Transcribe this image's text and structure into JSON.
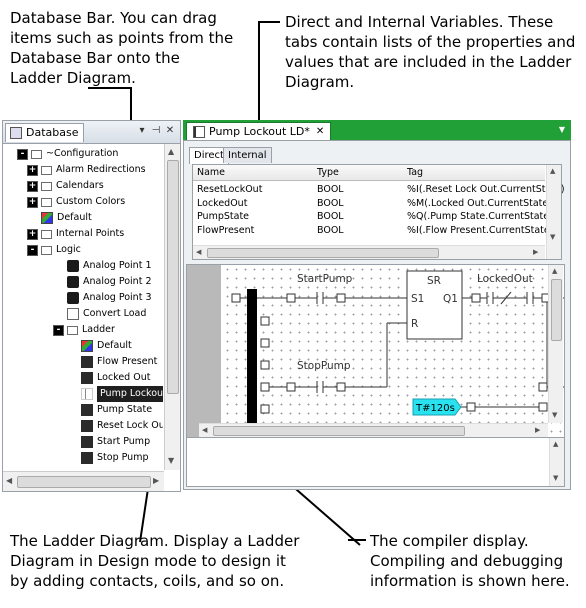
{
  "callouts": {
    "database_bar": "Database Bar. You can drag items such as points from the Database Bar onto the Ladder Diagram.",
    "variables": "Direct and Internal Variables. These tabs contain lists of the properties and values that are included in the Ladder Diagram.",
    "ladder": "The Ladder Diagram. Display a Ladder Diagram in Design mode to design it by adding contacts, coils, and so on.",
    "compiler": "The compiler display. Compiling and debugging information is shown here."
  },
  "database_pane": {
    "tab_label": "Database",
    "tree": [
      {
        "label": "~Configuration",
        "level": 0,
        "expander": "-",
        "icon": "folder-icon"
      },
      {
        "label": "Alarm Redirections",
        "level": 1,
        "expander": "+",
        "icon": "folder-icon"
      },
      {
        "label": "Calendars",
        "level": 1,
        "expander": "+",
        "icon": "folder-icon"
      },
      {
        "label": "Custom Colors",
        "level": 1,
        "expander": "+",
        "icon": "folder-icon"
      },
      {
        "label": "Default",
        "level": 1,
        "expander": "",
        "icon": "color-palette-icon"
      },
      {
        "label": "Internal Points",
        "level": 1,
        "expander": "+",
        "icon": "folder-icon"
      },
      {
        "label": "Logic",
        "level": 1,
        "expander": "-",
        "icon": "folder-icon"
      },
      {
        "label": "Analog Point 1",
        "level": 2,
        "expander": "",
        "icon": "analog-point-icon"
      },
      {
        "label": "Analog Point 2",
        "level": 2,
        "expander": "",
        "icon": "analog-point-icon"
      },
      {
        "label": "Analog Point 3",
        "level": 2,
        "expander": "",
        "icon": "analog-point-icon"
      },
      {
        "label": "Convert Load",
        "level": 2,
        "expander": "",
        "icon": "document-icon"
      },
      {
        "label": "Ladder",
        "level": 2,
        "expander": "-",
        "icon": "folder-icon"
      },
      {
        "label": "Default",
        "level": 3,
        "expander": "",
        "icon": "color-palette-icon"
      },
      {
        "label": "Flow Present",
        "level": 3,
        "expander": "",
        "icon": "digital-point-icon"
      },
      {
        "label": "Locked Out",
        "level": 3,
        "expander": "",
        "icon": "digital-point-icon"
      },
      {
        "label": "Pump Lockout LD",
        "level": 3,
        "expander": "",
        "icon": "ladder-diagram-icon",
        "selected": true
      },
      {
        "label": "Pump State",
        "level": 3,
        "expander": "",
        "icon": "digital-point-icon"
      },
      {
        "label": "Reset Lock Out",
        "level": 3,
        "expander": "",
        "icon": "digital-point-icon"
      },
      {
        "label": "Start Pump",
        "level": 3,
        "expander": "",
        "icon": "digital-point-icon"
      },
      {
        "label": "Stop Pump",
        "level": 3,
        "expander": "",
        "icon": "digital-point-icon"
      }
    ]
  },
  "document": {
    "tab_label": "Pump Lockout LD*",
    "var_tabs": [
      "Direct",
      "Internal"
    ],
    "columns": [
      "Name",
      "Type",
      "Tag"
    ],
    "rows": [
      [
        "ResetLockOut",
        "BOOL",
        "%I(.Reset Lock Out.CurrentState)"
      ],
      [
        "LockedOut",
        "BOOL",
        "%M(.Locked Out.CurrentState)"
      ],
      [
        "PumpState",
        "BOOL",
        "%Q(.Pump State.CurrentState)"
      ],
      [
        "FlowPresent",
        "BOOL",
        "%I(.Flow Present.CurrentState)"
      ]
    ]
  },
  "ladder": {
    "start_pump": "StartPump",
    "stop_pump": "StopPump",
    "locked_out": "LockedOut",
    "sr_title": "SR",
    "sr_s1": "S1",
    "sr_q1": "Q1",
    "sr_r": "R",
    "timer": "T#120s"
  },
  "colors": {
    "doc_tab_bar": "#21a038",
    "timer_fill": "#28e2f0",
    "selection": "#1f1f1f"
  }
}
